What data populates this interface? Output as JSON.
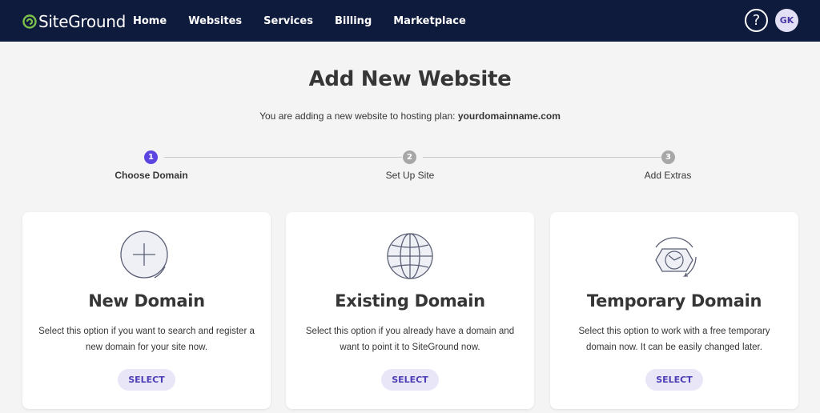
{
  "header": {
    "logo_text": "SiteGround",
    "nav": [
      "Home",
      "Websites",
      "Services",
      "Billing",
      "Marketplace"
    ],
    "help_label": "?",
    "avatar_initials": "GK",
    "colors": {
      "bar": "#0f1b3d",
      "logo_green": "#7cc04b"
    }
  },
  "main": {
    "title": "Add New Website",
    "subtitle_prefix": "You are adding a new website to hosting plan:",
    "subtitle_domain": "yourdomainname.com"
  },
  "steps": [
    {
      "number": "1",
      "label": "Choose Domain",
      "active": true
    },
    {
      "number": "2",
      "label": "Set Up Site",
      "active": false
    },
    {
      "number": "3",
      "label": "Add Extras",
      "active": false
    }
  ],
  "cards": [
    {
      "icon": "plus-circle-icon",
      "title": "New Domain",
      "desc_line1": "Select this option if you want to search and register a",
      "desc_line2": "new domain for your site now.",
      "button": "SELECT"
    },
    {
      "icon": "globe-icon",
      "title": "Existing Domain",
      "desc_line1": "Select this option if you already have a domain and",
      "desc_line2": "want to point it to SiteGround now.",
      "button": "SELECT"
    },
    {
      "icon": "clock-icon",
      "title": "Temporary Domain",
      "desc_line1": "Select this option to work with a free temporary",
      "desc_line2": "domain now. It can be easily changed later.",
      "button": "SELECT"
    }
  ],
  "colors": {
    "accent": "#5b45e0",
    "inactive_step": "#a7a7a7",
    "button_bg": "#e9e6f8",
    "button_text": "#4b3db5"
  }
}
